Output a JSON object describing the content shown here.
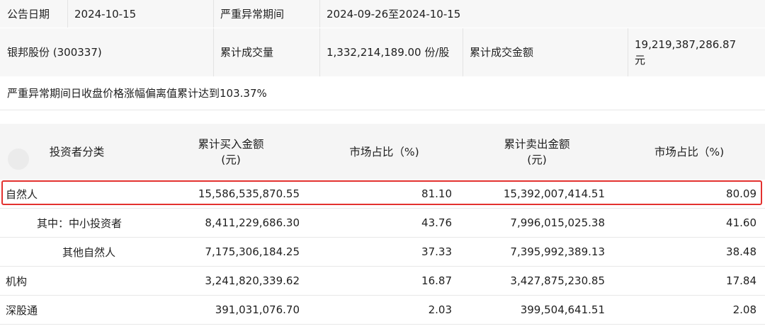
{
  "info": {
    "announce_date_label": "公告日期",
    "announce_date_value": "2024-10-15",
    "period_label": "严重异常期间",
    "period_value": "2024-09-26至2024-10-15",
    "stock_name": "银邦股份 (300337)",
    "volume_label": "累计成交量",
    "volume_value": "1,332,214,189.00 份/股",
    "amount_label": "累计成交金额",
    "amount_value_line1": "19,219,387,286.87",
    "amount_value_line2": "元",
    "deviation_note": "严重异常期间日收盘价格涨幅偏离值累计达到103.37%"
  },
  "table": {
    "headers": {
      "category": "投资者分类",
      "buy_line1": "累计买入金额",
      "buy_line2": "(元)",
      "buy_share": "市场占比（%)",
      "sell_line1": "累计卖出金额",
      "sell_line2": "(元)",
      "sell_share": "市场占比（%)"
    },
    "rows": [
      {
        "category": "自然人",
        "buy": "15,586,535,870.55",
        "buy_share": "81.10",
        "sell": "15,392,007,414.51",
        "sell_share": "80.09"
      },
      {
        "category": "其中：中小投资者",
        "buy": "8,411,229,686.30",
        "buy_share": "43.76",
        "sell": "7,996,015,025.38",
        "sell_share": "41.60"
      },
      {
        "category": "其他自然人",
        "buy": "7,175,306,184.25",
        "buy_share": "37.33",
        "sell": "7,395,992,389.13",
        "sell_share": "38.48"
      },
      {
        "category": "机构",
        "buy": "3,241,820,339.62",
        "buy_share": "16.87",
        "sell": "3,427,875,230.85",
        "sell_share": "17.84"
      },
      {
        "category": "深股通",
        "buy": "391,031,076.70",
        "buy_share": "2.03",
        "sell": "399,504,641.51",
        "sell_share": "2.08"
      }
    ]
  },
  "colors": {
    "highlight_border": "#e3312f",
    "header_bg": "#f5f5f5",
    "info_bg": "#f7f7f7"
  }
}
